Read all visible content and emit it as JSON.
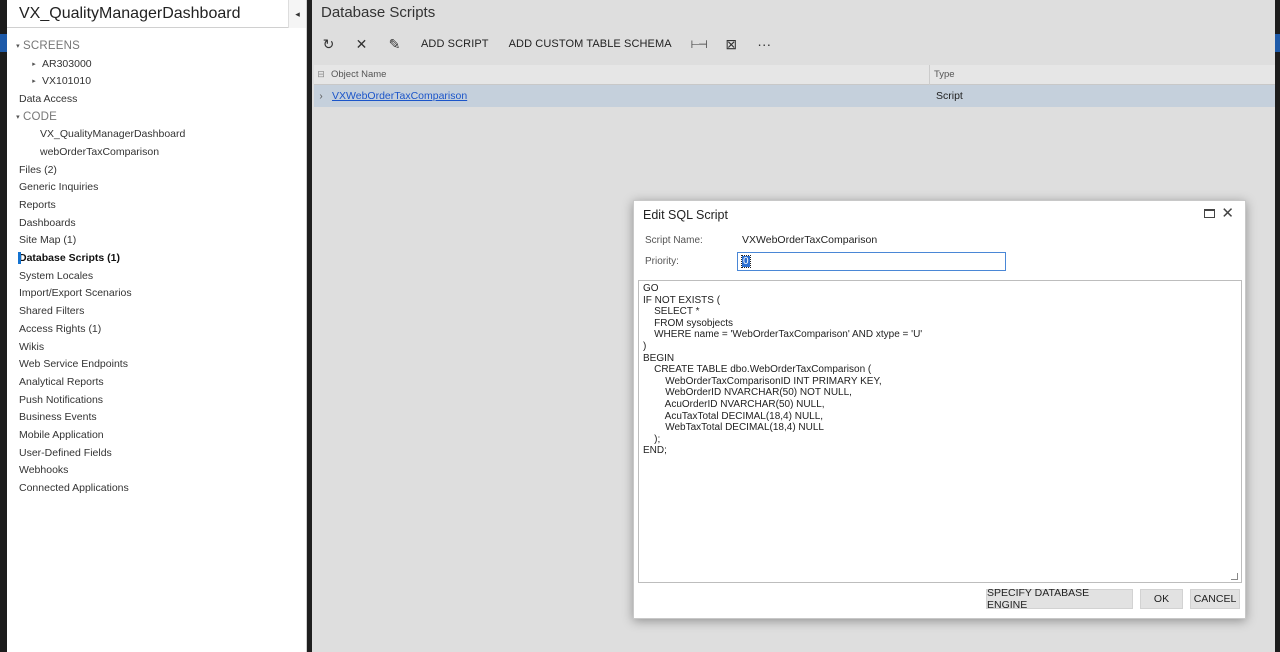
{
  "left_panel": {
    "title": "VX_QualityManagerDashboard",
    "collapse_icon": "◂",
    "items": [
      {
        "label": "SCREENS",
        "type": "section",
        "indent": 0,
        "arrow": "▾"
      },
      {
        "label": "AR303000",
        "type": "child",
        "indent": 1,
        "arrow": "▸"
      },
      {
        "label": "VX101010",
        "type": "child",
        "indent": 1,
        "arrow": "▸"
      },
      {
        "label": "Data Access",
        "type": "item",
        "indent": 0
      },
      {
        "label": "CODE",
        "type": "section",
        "indent": 0,
        "arrow": "▾"
      },
      {
        "label": "VX_QualityManagerDashboard",
        "type": "child",
        "indent": 2
      },
      {
        "label": "webOrderTaxComparison",
        "type": "child",
        "indent": 2
      },
      {
        "label": "Files (2)",
        "type": "item",
        "indent": 0
      },
      {
        "label": "Generic Inquiries",
        "type": "item",
        "indent": 0
      },
      {
        "label": "Reports",
        "type": "item",
        "indent": 0
      },
      {
        "label": "Dashboards",
        "type": "item",
        "indent": 0
      },
      {
        "label": "Site Map (1)",
        "type": "item",
        "indent": 0
      },
      {
        "label": "Database Scripts (1)",
        "type": "item",
        "indent": 0,
        "active": true
      },
      {
        "label": "System Locales",
        "type": "item",
        "indent": 0
      },
      {
        "label": "Import/Export Scenarios",
        "type": "item",
        "indent": 0
      },
      {
        "label": "Shared Filters",
        "type": "item",
        "indent": 0
      },
      {
        "label": "Access Rights (1)",
        "type": "item",
        "indent": 0
      },
      {
        "label": "Wikis",
        "type": "item",
        "indent": 0
      },
      {
        "label": "Web Service Endpoints",
        "type": "item",
        "indent": 0
      },
      {
        "label": "Analytical Reports",
        "type": "item",
        "indent": 0
      },
      {
        "label": "Push Notifications",
        "type": "item",
        "indent": 0
      },
      {
        "label": "Business Events",
        "type": "item",
        "indent": 0
      },
      {
        "label": "Mobile Application",
        "type": "item",
        "indent": 0
      },
      {
        "label": "User-Defined Fields",
        "type": "item",
        "indent": 0
      },
      {
        "label": "Webhooks",
        "type": "item",
        "indent": 0
      },
      {
        "label": "Connected Applications",
        "type": "item",
        "indent": 0
      }
    ]
  },
  "main": {
    "title": "Database Scripts",
    "toolbar": {
      "refresh_icon": "↻",
      "delete_icon": "✕",
      "edit_icon": "✎",
      "add_script": "ADD SCRIPT",
      "add_custom_table_schema": "ADD CUSTOM TABLE SCHEMA",
      "fit_icon": "⊢⊣",
      "export_icon": "⊠",
      "more_icon": "···"
    },
    "grid": {
      "col_icon": "⊟",
      "col_name": "Object Name",
      "col_type": "Type",
      "rows": [
        {
          "expand": "›",
          "name": "VXWebOrderTaxComparison",
          "type": "Script"
        }
      ]
    }
  },
  "dialog": {
    "title": "Edit SQL Script",
    "maximize_icon": "maximize-icon",
    "close_icon": "✕",
    "script_name_label": "Script Name:",
    "script_name_value": "VXWebOrderTaxComparison",
    "priority_label": "Priority:",
    "priority_value": "0",
    "sql": "GO\nIF NOT EXISTS (\n    SELECT *\n    FROM sysobjects\n    WHERE name = 'WebOrderTaxComparison' AND xtype = 'U'\n)\nBEGIN\n    CREATE TABLE dbo.WebOrderTaxComparison (\n        WebOrderTaxComparisonID INT PRIMARY KEY,\n        WebOrderID NVARCHAR(50) NOT NULL,\n        AcuOrderID NVARCHAR(50) NULL,\n        AcuTaxTotal DECIMAL(18,4) NULL,\n        WebTaxTotal DECIMAL(18,4) NULL\n    );\nEND;",
    "buttons": {
      "specify_engine": "SPECIFY DATABASE ENGINE",
      "ok": "OK",
      "cancel": "CANCEL"
    }
  }
}
